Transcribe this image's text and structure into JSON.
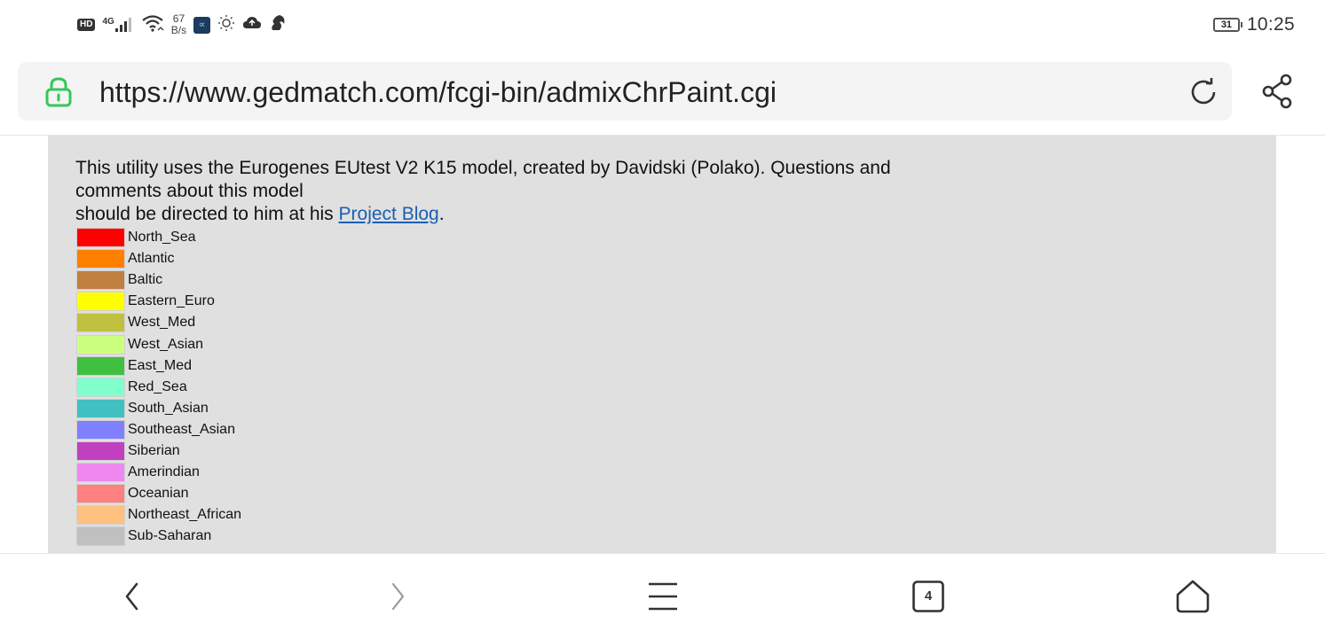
{
  "status_bar": {
    "hd": "HD",
    "network_type": "4G",
    "speed_value": "67",
    "speed_unit": "B/s",
    "battery": "31",
    "time": "10:25"
  },
  "address_bar": {
    "url": "https://www.gedmatch.com/fcgi-bin/admixChrPaint.cgi"
  },
  "page": {
    "intro_line1": "This utility uses the Eurogenes EUtest V2 K15 model, created by Davidski (Polako). Questions and comments about this model",
    "intro_line2_prefix": "should be directed to him at his ",
    "intro_link": "Project Blog",
    "intro_line2_suffix": ".",
    "legend": [
      {
        "label": "North_Sea",
        "color": "#ff0000"
      },
      {
        "label": "Atlantic",
        "color": "#ff8000"
      },
      {
        "label": "Baltic",
        "color": "#c08040"
      },
      {
        "label": "Eastern_Euro",
        "color": "#ffff00"
      },
      {
        "label": "West_Med",
        "color": "#c0c040"
      },
      {
        "label": "West_Asian",
        "color": "#ccff80"
      },
      {
        "label": "East_Med",
        "color": "#40c040"
      },
      {
        "label": "Red_Sea",
        "color": "#80ffcc"
      },
      {
        "label": "South_Asian",
        "color": "#40c0c0"
      },
      {
        "label": "Southeast_Asian",
        "color": "#8080ff"
      },
      {
        "label": "Siberian",
        "color": "#c040c0"
      },
      {
        "label": "Amerindian",
        "color": "#ee88f0"
      },
      {
        "label": "Oceanian",
        "color": "#ff8080"
      },
      {
        "label": "Northeast_African",
        "color": "#ffc080"
      },
      {
        "label": "Sub-Saharan",
        "color": "#c0c0c0"
      }
    ]
  },
  "bottom_nav": {
    "tab_count": "4"
  },
  "colors": {
    "lock_green": "#34c759",
    "link_blue": "#1a5fb4",
    "panel_gray": "#e0e0e0"
  }
}
